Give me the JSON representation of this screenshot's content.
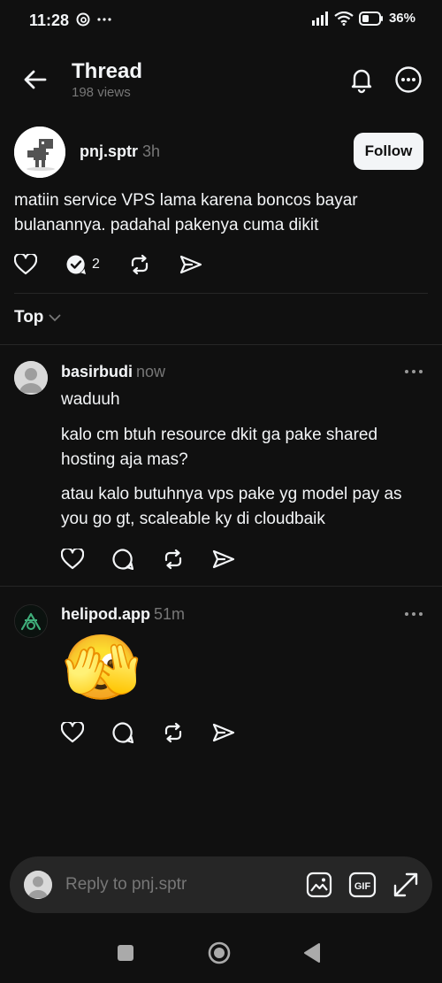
{
  "status_bar": {
    "time": "11:28",
    "battery": "36%"
  },
  "header": {
    "title": "Thread",
    "views": "198 views"
  },
  "op": {
    "username": "pnj.sptr",
    "time": "3h",
    "follow_label": "Follow",
    "text": "matiin service VPS lama karena boncos bayar bulanannya. padahal pakenya cuma dikit",
    "reply_count": "2"
  },
  "sort": {
    "label": "Top"
  },
  "replies": [
    {
      "username": "basirbudi",
      "time": "now",
      "paragraphs": [
        "waduuh",
        "kalo cm btuh resource dkit ga pake shared hosting aja mas?",
        "atau kalo butuhnya vps pake yg model pay as you go gt, scaleable ky di cloudbaik"
      ]
    },
    {
      "username": "helipod.app",
      "time": "51m",
      "emoji": "🫣"
    }
  ],
  "reply_bar": {
    "placeholder": "Reply to pnj.sptr"
  },
  "colors": {
    "background": "#101010",
    "text": "#f3f5f7",
    "muted": "#777777",
    "divider": "#262626"
  }
}
